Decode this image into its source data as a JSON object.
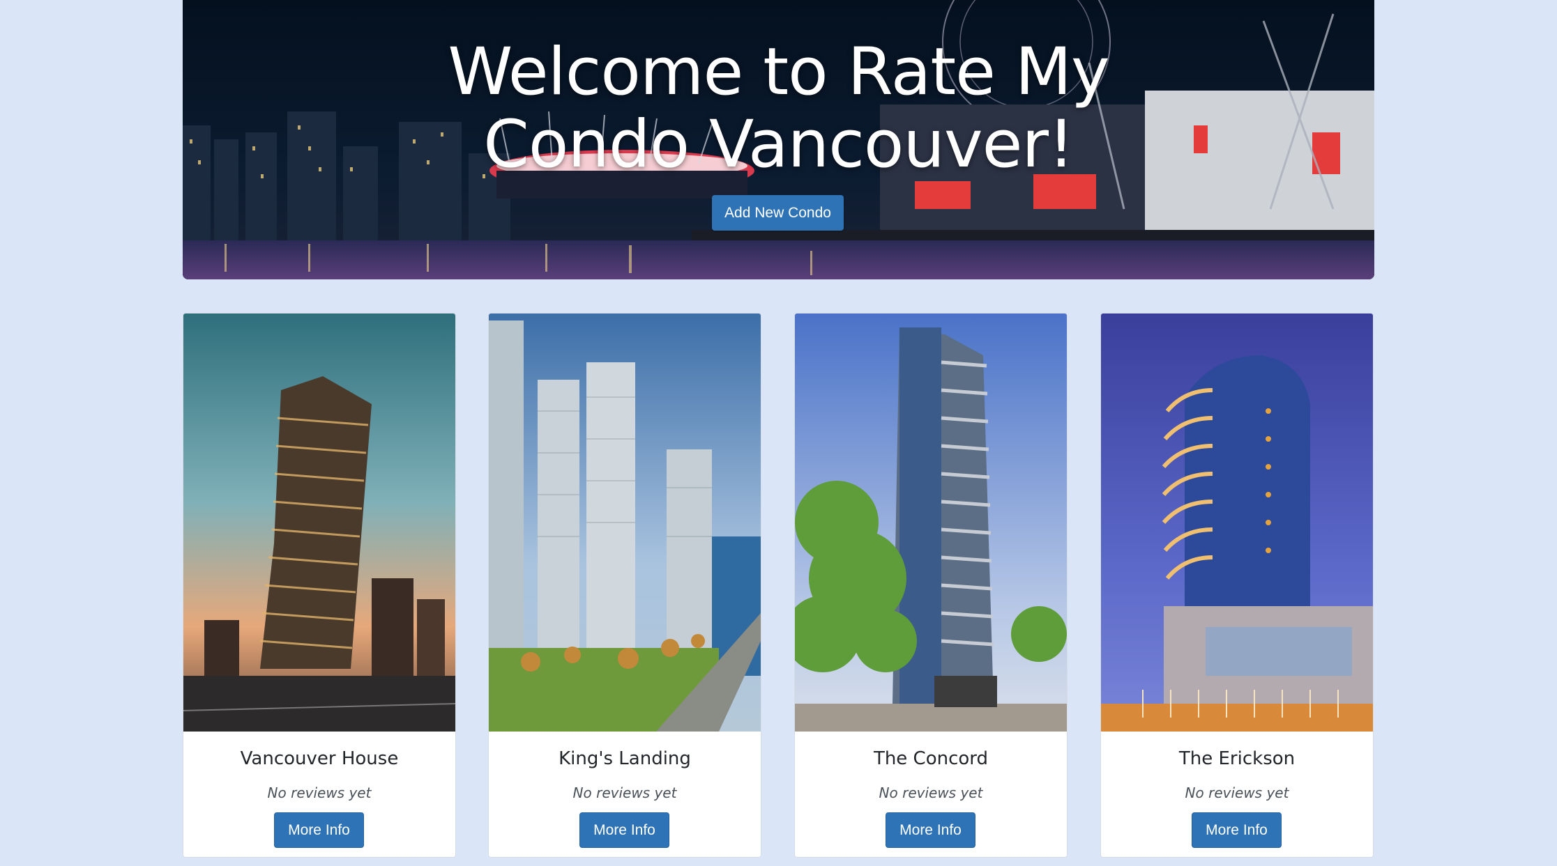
{
  "hero": {
    "title": "Welcome to Rate My Condo Vancouver!",
    "add_button_label": "Add New Condo"
  },
  "condos": [
    {
      "name": "Vancouver House",
      "reviews": "No reviews yet",
      "button_label": "More Info"
    },
    {
      "name": "King's Landing",
      "reviews": "No reviews yet",
      "button_label": "More Info"
    },
    {
      "name": "The Concord",
      "reviews": "No reviews yet",
      "button_label": "More Info"
    },
    {
      "name": "The Erickson",
      "reviews": "No reviews yet",
      "button_label": "More Info"
    }
  ],
  "colors": {
    "page_background": "#dbe5f8",
    "primary_button": "#2f73b7",
    "card_background": "#ffffff"
  }
}
